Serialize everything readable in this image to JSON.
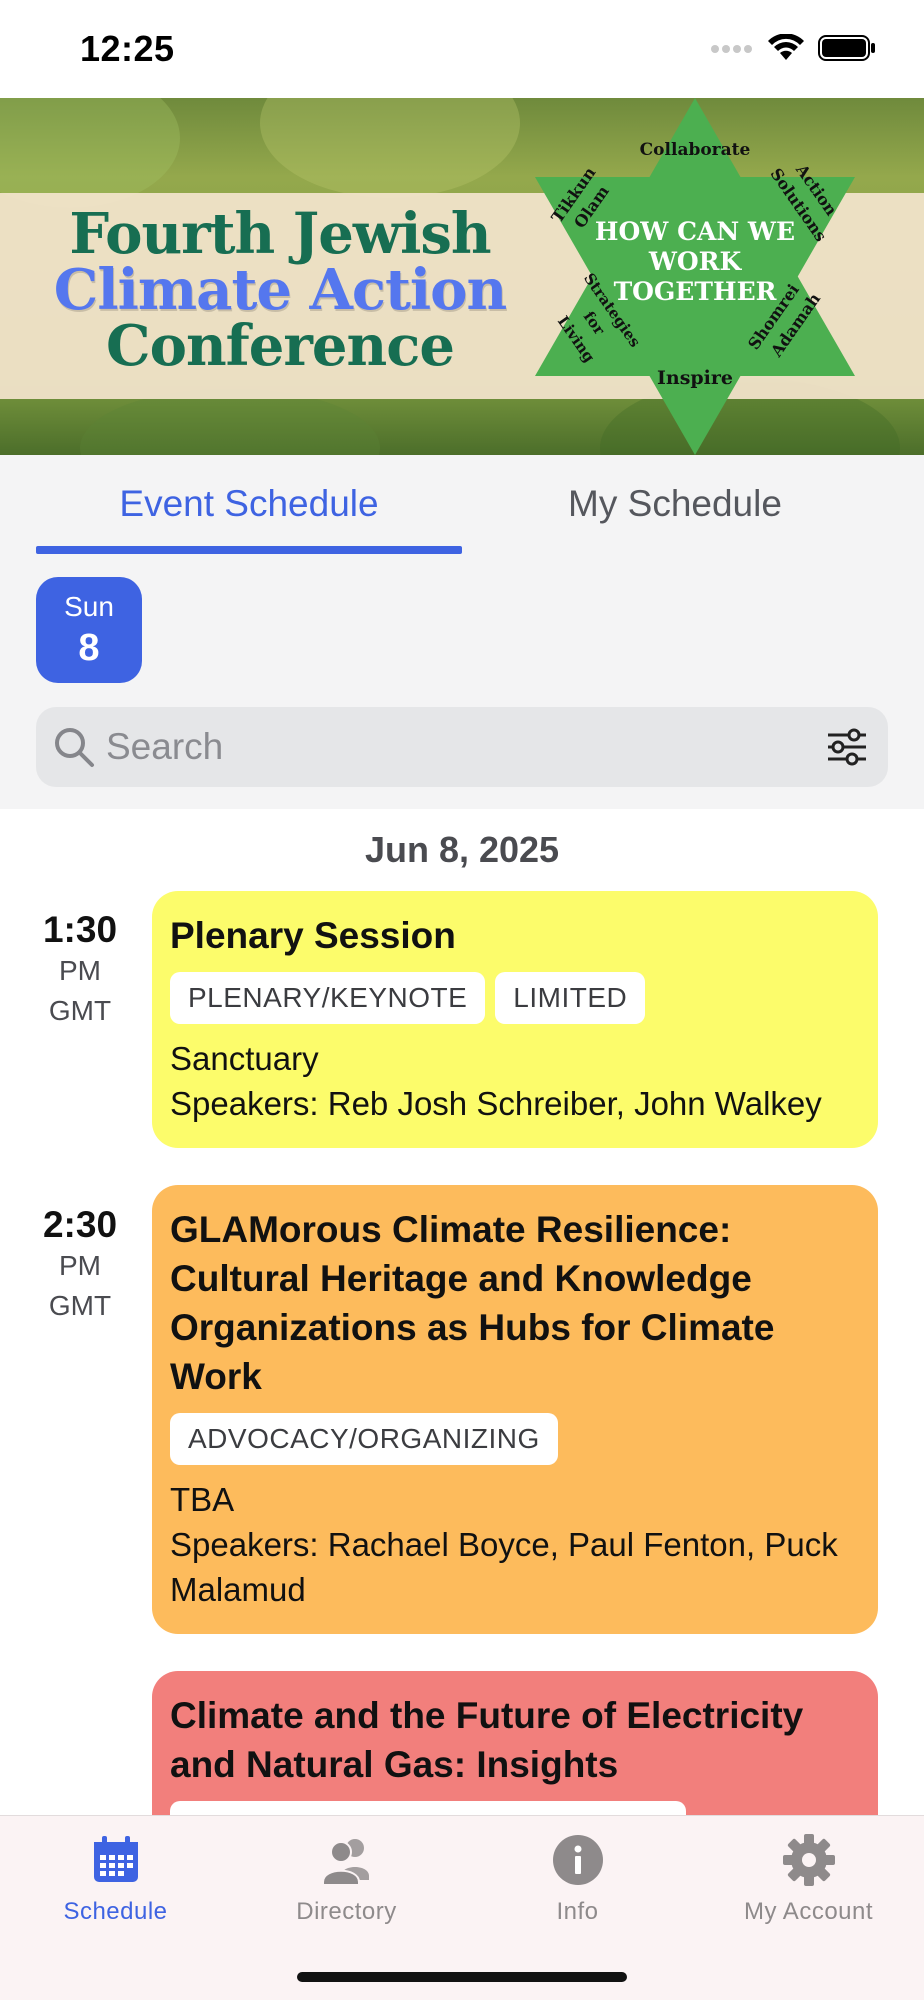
{
  "status_bar": {
    "time": "12:25"
  },
  "banner": {
    "title_line1": "Fourth Jewish",
    "title_line2": "Climate Action",
    "title_line3": "Conference",
    "star_center": [
      "HOW CAN WE",
      "WORK",
      "TOGETHER"
    ],
    "star_words": {
      "top": "Collaborate",
      "top_left": [
        "Tikkun",
        "Olam"
      ],
      "top_right": [
        "Action",
        "Solutions"
      ],
      "bottom_left": [
        "Strategies",
        "for",
        "Living"
      ],
      "bottom_right": [
        "Shomrei",
        "Adamah"
      ],
      "bottom": "Inspire"
    },
    "colors": {
      "green": "#176e52",
      "blue": "#5577ee",
      "star": "#4caf50"
    }
  },
  "tabs": {
    "event_schedule": "Event Schedule",
    "my_schedule": "My Schedule"
  },
  "day_selector": {
    "dow": "Sun",
    "day": "8"
  },
  "search": {
    "placeholder": "Search"
  },
  "schedule": {
    "date": "Jun 8, 2025",
    "sessions": [
      {
        "time": "1:30",
        "ampm": "PM",
        "tz": "GMT",
        "title": "Plenary Session",
        "tags": [
          "PLENARY/KEYNOTE",
          "LIMITED"
        ],
        "location": "Sanctuary",
        "speakers": "Speakers: Reb Josh Schreiber, John Walkey",
        "color": "#fcfc6b"
      },
      {
        "time": "2:30",
        "ampm": "PM",
        "tz": "GMT",
        "title": "GLAMorous Climate Resilience: Cultural Heritage and Knowledge Organizations as Hubs for Climate Work",
        "tags": [
          "ADVOCACY/ORGANIZING"
        ],
        "location": "TBA",
        "speakers": "Speakers: Rachael Boyce, Paul Fenton, Puck Malamud",
        "color": "#fdbb5c"
      },
      {
        "title": "Climate and the Future of Electricity and Natural Gas: Insights",
        "color": "#f27f7c"
      }
    ]
  },
  "tab_bar": {
    "schedule": "Schedule",
    "directory": "Directory",
    "info": "Info",
    "my_account": "My Account",
    "active_color": "#3e63e2",
    "inactive_color": "#8e8a8b"
  },
  "icons": [
    "search-icon",
    "filter-icon",
    "calendar-icon",
    "people-icon",
    "info-icon",
    "gear-icon",
    "wifi-icon",
    "battery-icon",
    "signal-icon"
  ]
}
